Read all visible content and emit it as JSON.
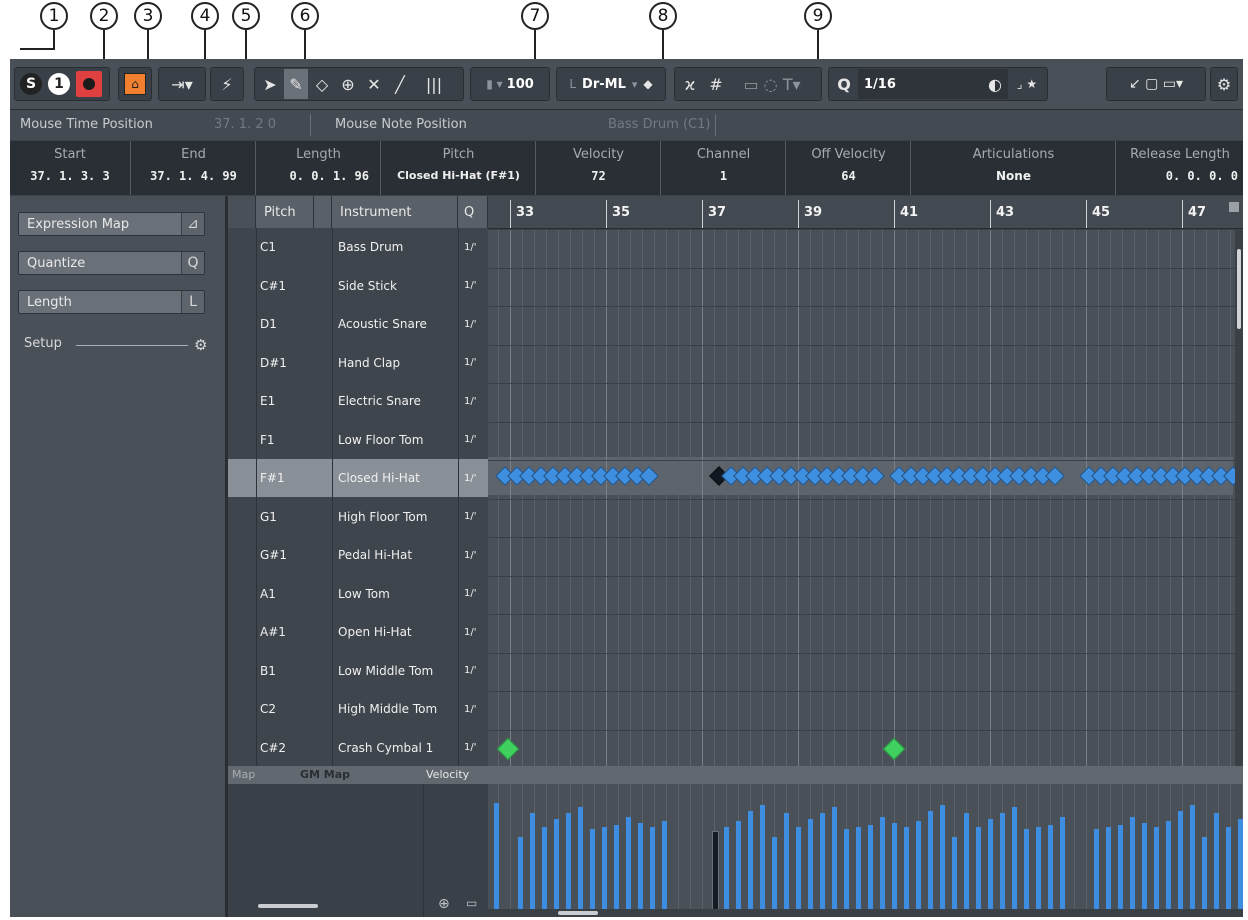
{
  "callouts": [
    "1",
    "2",
    "3",
    "4",
    "5",
    "6",
    "7",
    "8",
    "9"
  ],
  "toolbar": {
    "solo": "S",
    "listen": "1",
    "velocity_value": "100",
    "insert_length": "Dr-ML",
    "quantize_value": "1/16",
    "icons": [
      "solo-icon",
      "listen-icon",
      "record-icon",
      "autoscroll-icon",
      "locator-icon",
      "object-select-icon",
      "draw-icon",
      "erase-icon",
      "zoom-icon",
      "mute-icon",
      "line-icon",
      "split-icon",
      "snap-icon",
      "grid-icon",
      "settings-icon"
    ]
  },
  "statusbar": {
    "mouse_time_label": "Mouse Time Position",
    "mouse_time_value": "37.  1.  2  0",
    "mouse_note_label": "Mouse Note Position",
    "mouse_note_value": "Bass Drum (C1)"
  },
  "infoline": [
    {
      "label": "Start",
      "value": "37. 1. 3.  3"
    },
    {
      "label": "End",
      "value": "37. 1. 4. 99"
    },
    {
      "label": "Length",
      "value": "0. 0. 1. 96"
    },
    {
      "label": "Pitch",
      "value": "Closed Hi-Hat (F#1)"
    },
    {
      "label": "Velocity",
      "value": "72"
    },
    {
      "label": "Channel",
      "value": "1"
    },
    {
      "label": "Off Velocity",
      "value": "64"
    },
    {
      "label": "Articulations",
      "value": "None"
    },
    {
      "label": "Release Length",
      "value": "0. 0. 0.  0"
    }
  ],
  "inspector": {
    "expression_map": "Expression Map",
    "quantize": "Quantize",
    "quantize_icon": "Q",
    "length": "Length",
    "length_icon": "L",
    "setup": "Setup"
  },
  "drumlist": {
    "headers": [
      "Pitch",
      "Instrument",
      "Q"
    ],
    "rows": [
      {
        "pitch": "C1",
        "instrument": "Bass Drum",
        "q": "1/'"
      },
      {
        "pitch": "C#1",
        "instrument": "Side Stick",
        "q": "1/'"
      },
      {
        "pitch": "D1",
        "instrument": "Acoustic Snare",
        "q": "1/'"
      },
      {
        "pitch": "D#1",
        "instrument": "Hand Clap",
        "q": "1/'"
      },
      {
        "pitch": "E1",
        "instrument": "Electric Snare",
        "q": "1/'"
      },
      {
        "pitch": "F1",
        "instrument": "Low Floor Tom",
        "q": "1/'"
      },
      {
        "pitch": "F#1",
        "instrument": "Closed Hi-Hat",
        "q": "1/'"
      },
      {
        "pitch": "G1",
        "instrument": "High Floor Tom",
        "q": "1/'"
      },
      {
        "pitch": "G#1",
        "instrument": "Pedal Hi-Hat",
        "q": "1/'"
      },
      {
        "pitch": "A1",
        "instrument": "Low Tom",
        "q": "1/'"
      },
      {
        "pitch": "A#1",
        "instrument": "Open Hi-Hat",
        "q": "1/'"
      },
      {
        "pitch": "B1",
        "instrument": "Low Middle Tom",
        "q": "1/'"
      },
      {
        "pitch": "C2",
        "instrument": "High Middle Tom",
        "q": "1/'"
      },
      {
        "pitch": "C#2",
        "instrument": "Crash Cymbal 1",
        "q": "1/'"
      }
    ],
    "selected_row": 6
  },
  "ruler": {
    "bars": [
      "33",
      "35",
      "37",
      "39",
      "41",
      "43",
      "45",
      "47"
    ]
  },
  "lane": {
    "map_label": "Map",
    "map_value": "GM Map",
    "controller": "Velocity"
  }
}
